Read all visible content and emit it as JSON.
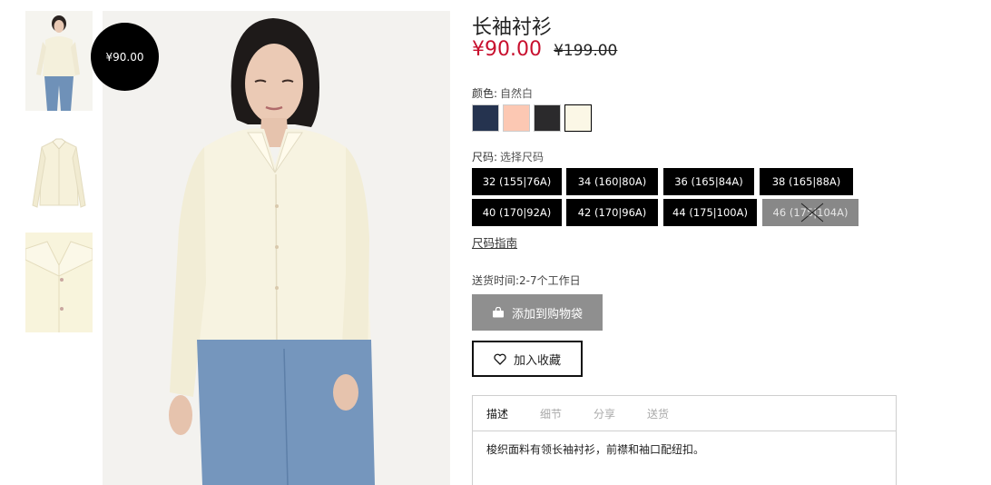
{
  "badge": {
    "price": "¥90.00"
  },
  "product": {
    "title": "长袖衬衫",
    "price_now": "¥90.00",
    "price_old": "¥199.00"
  },
  "color": {
    "label": "颜色:",
    "selected": "自然白",
    "swatches": [
      {
        "name": "navy",
        "hex": "#25334f"
      },
      {
        "name": "peach",
        "hex": "#fcc8b3"
      },
      {
        "name": "black",
        "hex": "#2b2a2c"
      },
      {
        "name": "natural-white",
        "hex": "#fbf7e6",
        "selected": true
      }
    ]
  },
  "size": {
    "label": "尺码:",
    "prompt": "选择尺码",
    "options": [
      {
        "label": "32 (155|76A)",
        "available": true
      },
      {
        "label": "34 (160|80A)",
        "available": true
      },
      {
        "label": "36 (165|84A)",
        "available": true
      },
      {
        "label": "38 (165|88A)",
        "available": true
      },
      {
        "label": "40 (170|92A)",
        "available": true
      },
      {
        "label": "42 (170|96A)",
        "available": true
      },
      {
        "label": "44 (175|100A)",
        "available": true
      },
      {
        "label": "46 (175|104A)",
        "available": false
      }
    ],
    "guide": "尺码指南"
  },
  "delivery": "送货时间:2-7个工作日",
  "actions": {
    "add_to_bag": "添加到购物袋",
    "add_to_favorites": "加入收藏",
    "bag_icon": "shopping-bag-icon",
    "heart_icon": "heart-icon"
  },
  "tabs": [
    {
      "label": "描述",
      "active": true
    },
    {
      "label": "细节",
      "active": false
    },
    {
      "label": "分享",
      "active": false
    },
    {
      "label": "送货",
      "active": false
    }
  ],
  "description": "梭织面料有领长袖衬衫，前襟和袖口配纽扣。",
  "colors": {
    "accent_price": "#c8102e",
    "button_gray": "#8f8f8f",
    "size_button": "#000000",
    "size_button_disabled": "#888888"
  }
}
